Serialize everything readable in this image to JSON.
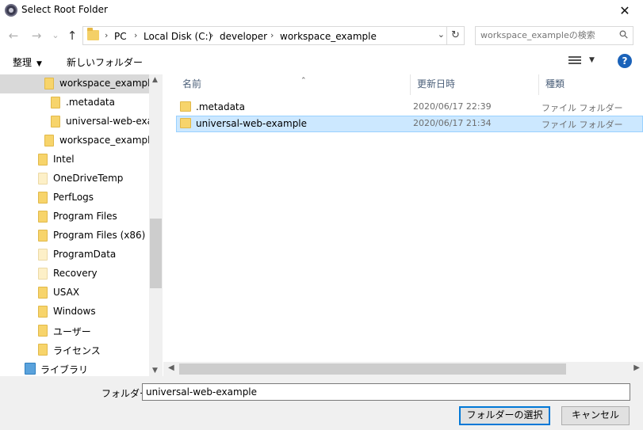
{
  "window": {
    "title": "Select Root Folder",
    "close_glyph": "✕",
    "icon": "eclipse-app-icon"
  },
  "nav": {
    "back_glyph": "←",
    "forward_glyph": "→",
    "recent_glyph": "⌄",
    "up_glyph": "↑",
    "breadcrumbs": [
      "PC",
      "Local Disk (C:)",
      "developer",
      "workspace_example"
    ],
    "separator": "›",
    "dropdown_glyph": "⌄",
    "refresh_glyph": "↻",
    "search_placeholder": "workspace_exampleの検索",
    "search_glyph": "⚲"
  },
  "toolbar": {
    "organize_label": "整理",
    "organize_caret": "▼",
    "new_folder_label": "新しいフォルダー",
    "view_caret": "▼",
    "help_glyph": "?"
  },
  "tree": {
    "items": [
      {
        "label": "workspace_example",
        "selected": true,
        "icon": "folder-icon"
      },
      {
        "label": ".metadata",
        "icon": "folder-icon"
      },
      {
        "label": "universal-web-exam",
        "icon": "folder-icon"
      },
      {
        "label": "workspace_example_",
        "icon": "folder-icon"
      },
      {
        "label": "Intel",
        "icon": "folder-icon"
      },
      {
        "label": "OneDriveTemp",
        "icon": "folder-icon-pale"
      },
      {
        "label": "PerfLogs",
        "icon": "folder-icon"
      },
      {
        "label": "Program Files",
        "icon": "folder-icon"
      },
      {
        "label": "Program Files (x86)",
        "icon": "folder-icon"
      },
      {
        "label": "ProgramData",
        "icon": "folder-icon-pale"
      },
      {
        "label": "Recovery",
        "icon": "folder-icon-pale"
      },
      {
        "label": "USAX",
        "icon": "folder-icon"
      },
      {
        "label": "Windows",
        "icon": "folder-icon"
      },
      {
        "label": "ユーザー",
        "icon": "folder-icon"
      },
      {
        "label": "ライセンス",
        "icon": "folder-icon"
      },
      {
        "label": "ライブラリ",
        "icon": "library-icon"
      }
    ],
    "scroll_up": "▲",
    "scroll_down": "▼"
  },
  "files": {
    "columns": [
      "名前",
      "更新日時",
      "種類"
    ],
    "sort_glyph": "⌃",
    "rows": [
      {
        "name": ".metadata",
        "date": "2020/06/17 22:39",
        "type": "ファイル フォルダー",
        "selected": false
      },
      {
        "name": "universal-web-example",
        "date": "2020/06/17 21:34",
        "type": "ファイル フォルダー",
        "selected": true
      }
    ],
    "scroll_left": "◀",
    "scroll_right": "▶"
  },
  "footer": {
    "folder_label": "フォルダー:",
    "folder_value": "universal-web-example",
    "select_button": "フォルダーの選択",
    "cancel_button": "キャンセル"
  },
  "colors": {
    "accent": "#0078d7",
    "selection": "#cce8ff",
    "tree_selection": "#d9d9d9",
    "folder": "#f7d46b"
  }
}
